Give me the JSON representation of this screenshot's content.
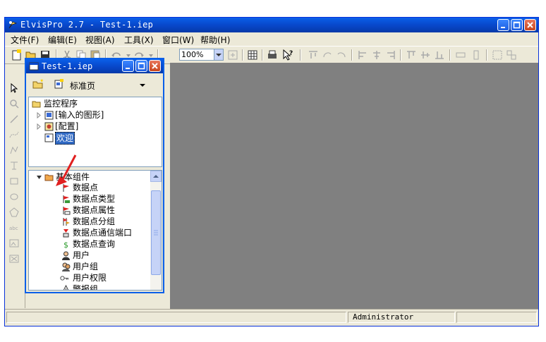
{
  "app": {
    "title": "ElvisPro 2.7 - Test-1.iep"
  },
  "menu": [
    "文件(F)",
    "编辑(E)",
    "视图(A)",
    "工具(X)",
    "窗口(W)",
    "帮助(H)"
  ],
  "toolbar": {
    "zoom_value": "100%"
  },
  "child_window": {
    "title": "Test-1.iep",
    "page_label": "标准页",
    "tree_root": "监控程序",
    "tree_items": [
      "[输入的图形]",
      "[配置]"
    ],
    "selected_item": "欢迎"
  },
  "components": {
    "header": "基本组件",
    "items": [
      "数据点",
      "数据点类型",
      "数据点属性",
      "数据点分组",
      "数据点通信端口",
      "数据点查询",
      "用户",
      "用户组",
      "用户权限",
      "警报组"
    ]
  },
  "status": {
    "user": "Administrator"
  },
  "colors": {
    "title_bar": "#0a5fe8",
    "workspace": "#808080",
    "panel": "#ece9d8",
    "arrow": "#e02020"
  }
}
